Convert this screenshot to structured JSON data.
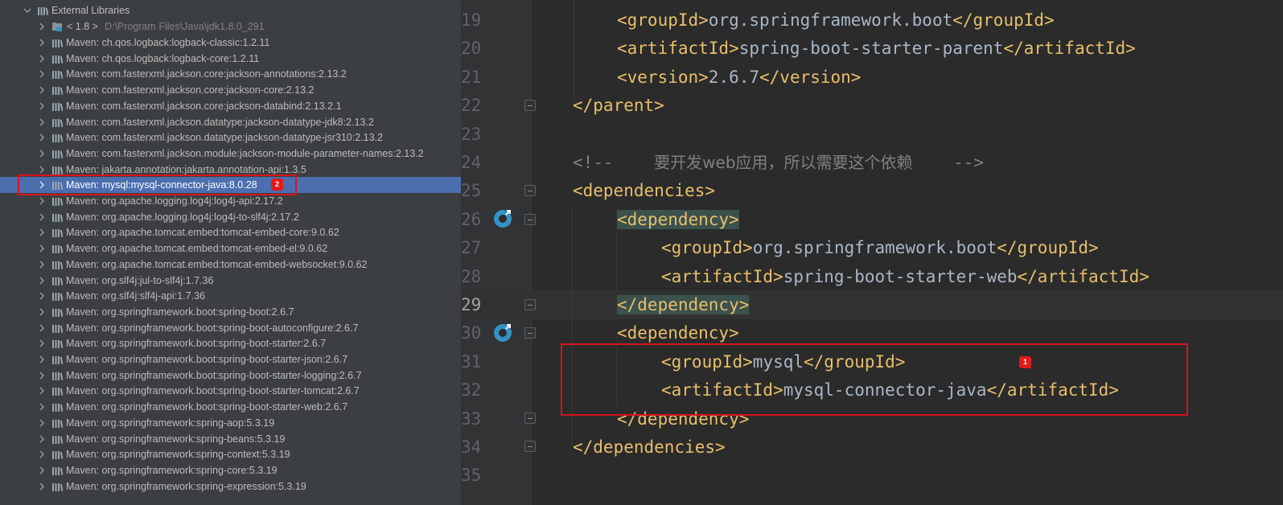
{
  "tree": {
    "root_label": "External Libraries",
    "sdk": {
      "label": "< 1.8 >",
      "path": "D:\\Program Files\\Java\\jdk1.8.0_291"
    },
    "libraries": [
      "Maven: ch.qos.logback:logback-classic:1.2.11",
      "Maven: ch.qos.logback:logback-core:1.2.11",
      "Maven: com.fasterxml.jackson.core:jackson-annotations:2.13.2",
      "Maven: com.fasterxml.jackson.core:jackson-core:2.13.2",
      "Maven: com.fasterxml.jackson.core:jackson-databind:2.13.2.1",
      "Maven: com.fasterxml.jackson.datatype:jackson-datatype-jdk8:2.13.2",
      "Maven: com.fasterxml.jackson.datatype:jackson-datatype-jsr310:2.13.2",
      "Maven: com.fasterxml.jackson.module:jackson-module-parameter-names:2.13.2",
      "Maven: jakarta.annotation:jakarta.annotation-api:1.3.5",
      "Maven: mysql:mysql-connector-java:8.0.28",
      "Maven: org.apache.logging.log4j:log4j-api:2.17.2",
      "Maven: org.apache.logging.log4j:log4j-to-slf4j:2.17.2",
      "Maven: org.apache.tomcat.embed:tomcat-embed-core:9.0.62",
      "Maven: org.apache.tomcat.embed:tomcat-embed-el:9.0.62",
      "Maven: org.apache.tomcat.embed:tomcat-embed-websocket:9.0.62",
      "Maven: org.slf4j:jul-to-slf4j:1.7.36",
      "Maven: org.slf4j:slf4j-api:1.7.36",
      "Maven: org.springframework.boot:spring-boot:2.6.7",
      "Maven: org.springframework.boot:spring-boot-autoconfigure:2.6.7",
      "Maven: org.springframework.boot:spring-boot-starter:2.6.7",
      "Maven: org.springframework.boot:spring-boot-starter-json:2.6.7",
      "Maven: org.springframework.boot:spring-boot-starter-logging:2.6.7",
      "Maven: org.springframework.boot:spring-boot-starter-tomcat:2.6.7",
      "Maven: org.springframework.boot:spring-boot-starter-web:2.6.7",
      "Maven: org.springframework:spring-aop:5.3.19",
      "Maven: org.springframework:spring-beans:5.3.19",
      "Maven: org.springframework:spring-context:5.3.19",
      "Maven: org.springframework:spring-core:5.3.19",
      "Maven: org.springframework:spring-expression:5.3.19"
    ],
    "selected_library": "Maven: mysql:mysql-connector-java:8.0.28"
  },
  "editor": {
    "current_line": "29",
    "lines": [
      {
        "num": "19",
        "tokens": [
          [
            "tag",
            "<groupId>"
          ],
          [
            "txt",
            "org.springframework.boot"
          ],
          [
            "tag",
            "</groupId>"
          ]
        ]
      },
      {
        "num": "20",
        "tokens": [
          [
            "tag",
            "<artifactId>"
          ],
          [
            "txt",
            "spring-boot-starter-parent"
          ],
          [
            "tag",
            "</artifactId>"
          ]
        ]
      },
      {
        "num": "21",
        "tokens": [
          [
            "tag",
            "<version>"
          ],
          [
            "txt",
            "2.6.7"
          ],
          [
            "tag",
            "</version>"
          ]
        ]
      },
      {
        "num": "22",
        "tokens": [
          [
            "tag",
            "</parent>"
          ]
        ]
      },
      {
        "num": "23",
        "tokens": []
      },
      {
        "num": "24",
        "tokens": [
          [
            "cmt",
            "<!--    "
          ],
          [
            "cmt-cn",
            "要开发web应用，所以需要这个依赖"
          ],
          [
            "cmt",
            "    -->"
          ]
        ]
      },
      {
        "num": "25",
        "tokens": [
          [
            "tag",
            "<dependencies>"
          ]
        ]
      },
      {
        "num": "26",
        "tokens": [
          [
            "tag hl",
            "<"
          ],
          [
            "tag hl",
            "dependency>"
          ]
        ]
      },
      {
        "num": "27",
        "tokens": [
          [
            "tag",
            "<groupId>"
          ],
          [
            "txt",
            "org.springframework.boot"
          ],
          [
            "tag",
            "</groupId>"
          ]
        ]
      },
      {
        "num": "28",
        "tokens": [
          [
            "tag",
            "<artifactId>"
          ],
          [
            "txt",
            "spring-boot-starter-web"
          ],
          [
            "tag",
            "</artifactId>"
          ]
        ]
      },
      {
        "num": "29",
        "tokens": [
          [
            "tag hl",
            "</dependency>"
          ]
        ]
      },
      {
        "num": "30",
        "tokens": [
          [
            "tag",
            "<dependency>"
          ]
        ]
      },
      {
        "num": "31",
        "tokens": [
          [
            "tag",
            "<groupId>"
          ],
          [
            "txt",
            "mysql"
          ],
          [
            "tag",
            "</groupId>"
          ]
        ]
      },
      {
        "num": "32",
        "tokens": [
          [
            "tag",
            "<artifactId>"
          ],
          [
            "txt",
            "mysql-connector-java"
          ],
          [
            "tag",
            "</artifactId>"
          ]
        ]
      },
      {
        "num": "33",
        "tokens": [
          [
            "tag",
            "</dependency>"
          ]
        ]
      },
      {
        "num": "34",
        "tokens": [
          [
            "tag",
            "</dependencies>"
          ]
        ]
      },
      {
        "num": "35",
        "tokens": []
      }
    ]
  },
  "annotations": {
    "badge_1": "1",
    "badge_2": "2"
  },
  "colors": {
    "accent_selection": "#4b6eaf",
    "tag": "#e8bf6a",
    "text": "#a9b7c6",
    "annotation_red": "#d9121f"
  }
}
